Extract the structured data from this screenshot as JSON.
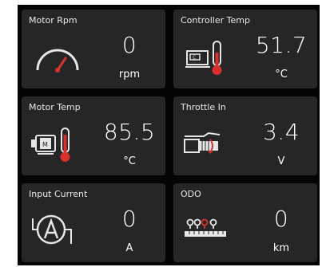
{
  "colors": {
    "accent_red": "#d6312f",
    "card_bg": "#262626",
    "frame_bg": "#050505"
  },
  "cards": [
    {
      "title": "Motor Rpm",
      "value": "0",
      "unit": "rpm",
      "icon": "speedometer-icon"
    },
    {
      "title": "Controller Temp",
      "value": "51.7",
      "unit": "°C",
      "icon": "controller-thermometer-icon"
    },
    {
      "title": "Motor Temp",
      "value": "85.5",
      "unit": "°C",
      "icon": "motor-thermometer-icon"
    },
    {
      "title": "Throttle In",
      "value": "3.4",
      "unit": "V",
      "icon": "throttle-grip-icon"
    },
    {
      "title": "Input Current",
      "value": "0",
      "unit": "A",
      "icon": "ammeter-icon"
    },
    {
      "title": "ODO",
      "value": "0",
      "unit": "km",
      "icon": "odometer-ruler-icon"
    }
  ]
}
